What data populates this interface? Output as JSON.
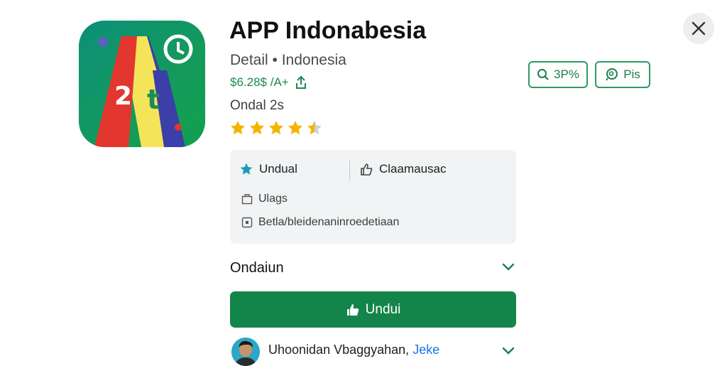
{
  "app": {
    "title": "APP Indonabesia",
    "subtitle": "Detail • Indonesia",
    "price": "$6.28$ /A+",
    "downloads": "Ondal 2s",
    "rating": 4.5
  },
  "chips": [
    {
      "label": "3P%",
      "icon": "zoom-icon"
    },
    {
      "label": "Pis",
      "icon": "chat-search-icon"
    }
  ],
  "info_card": {
    "item1": "Undual",
    "item2": "Claamausac",
    "item3": "Ulags",
    "item4": "Betla/bleidenaninroedetiaan"
  },
  "section": {
    "title": "Ondaiun"
  },
  "download_button": {
    "label": "Undui"
  },
  "review": {
    "name": "Uhoonidan Vbaggyahan,",
    "link": "Jeke"
  },
  "colors": {
    "primary": "#14854a",
    "accent": "#2e9a63",
    "card": "#f1f3f4",
    "star": "#f4b400",
    "link": "#1a73e8"
  }
}
